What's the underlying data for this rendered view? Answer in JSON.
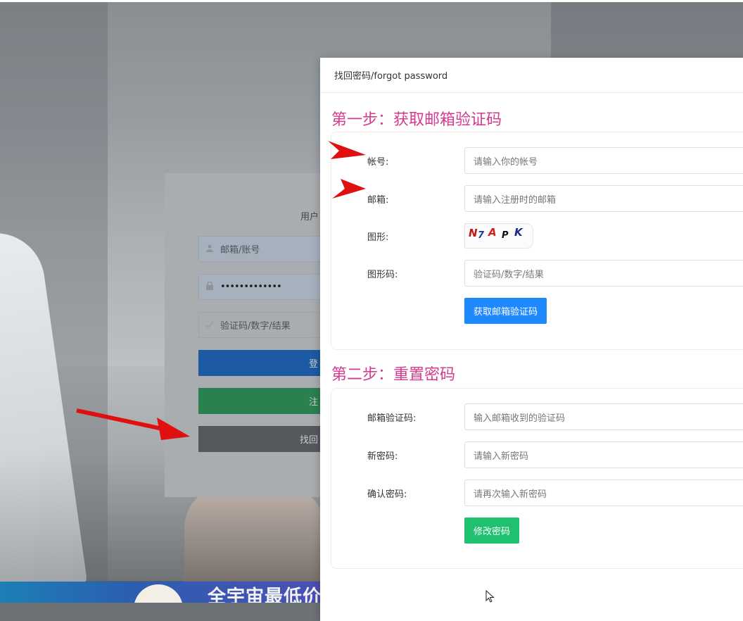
{
  "background": {
    "banner_text": "全宇宙最低价"
  },
  "login": {
    "title": "用户",
    "username_placeholder": "邮箱/账号",
    "password_value": "•••••••••••••",
    "captcha_placeholder": "验证码/数字/结果",
    "login_label": "登",
    "register_label": "注",
    "find_label": "找回",
    "icons": {
      "user": "user-icon",
      "lock": "lock-icon",
      "check": "check-icon"
    }
  },
  "modal": {
    "title": "找回密码/forgot password",
    "step1": {
      "title": "第一步：获取邮箱验证码",
      "account_label": "帐号:",
      "account_placeholder": "请输入你的帐号",
      "email_label": "邮箱:",
      "email_placeholder": "请输入注册时的邮箱",
      "image_label": "图形:",
      "captcha_chars": [
        "N",
        "7",
        "A",
        "P",
        "K"
      ],
      "image_code_label": "图形码:",
      "image_code_placeholder": "验证码/数字/结果",
      "button": "获取邮箱验证码"
    },
    "step2": {
      "title": "第二步：重置密码",
      "code_label": "邮箱验证码:",
      "code_placeholder": "输入邮箱收到的验证码",
      "new_label": "新密码:",
      "new_placeholder": "请输入新密码",
      "confirm_label": "确认密码:",
      "confirm_placeholder": "请再次输入新密码",
      "button": "修改密码"
    }
  },
  "colors": {
    "step_title": "#d63a8f",
    "primary_button": "#1e88ff",
    "success_button": "#1fc171",
    "arrow": "#e01010"
  }
}
